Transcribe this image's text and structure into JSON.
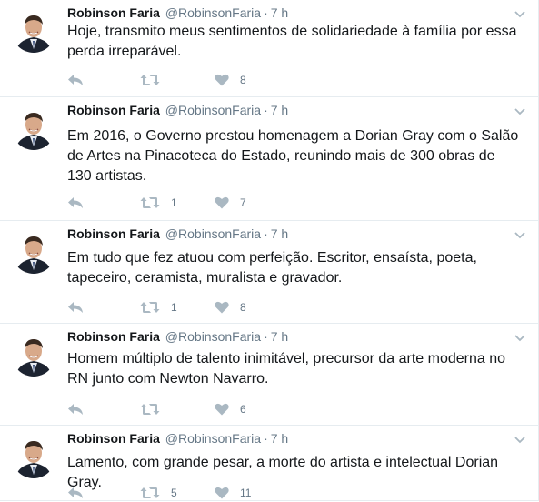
{
  "tweets": [
    {
      "fullname": "Robinson Faria",
      "username": "@RobinsonFaria",
      "time": "7 h",
      "text": "Hoje, transmito meus sentimentos de solidariedade à família por essa perda irreparável.",
      "retweets": "",
      "likes": "8"
    },
    {
      "fullname": "Robinson Faria",
      "username": "@RobinsonFaria",
      "time": "7 h",
      "text": "Em 2016, o Governo prestou homenagem a Dorian Gray com o Salão de Artes na Pinacoteca do Estado, reunindo mais de 300 obras de 130 artistas.",
      "retweets": "1",
      "likes": "7"
    },
    {
      "fullname": "Robinson Faria",
      "username": "@RobinsonFaria",
      "time": "7 h",
      "text": "Em tudo que fez atuou com perfeição. Escritor, ensaísta, poeta, tapeceiro, ceramista, muralista e gravador.",
      "retweets": "1",
      "likes": "8"
    },
    {
      "fullname": "Robinson Faria",
      "username": "@RobinsonFaria",
      "time": "7 h",
      "text": "Homem múltiplo de talento inimitável, precursor da arte moderna no RN junto com Newton Navarro.",
      "retweets": "",
      "likes": "6"
    },
    {
      "fullname": "Robinson Faria",
      "username": "@RobinsonFaria",
      "time": "7 h",
      "text": "Lamento, com grande pesar, a morte do artista e intelectual Dorian Gray.",
      "retweets": "5",
      "likes": "11"
    }
  ],
  "separator": "·",
  "icons": {
    "reply": "reply-icon",
    "retweet": "retweet-icon",
    "like": "heart-icon",
    "caret": "chevron-down-icon",
    "avatar": "avatar"
  },
  "colors": {
    "name": "#14171a",
    "meta": "#657786",
    "icon": "#aab8c2",
    "border": "#e6ecf0"
  }
}
